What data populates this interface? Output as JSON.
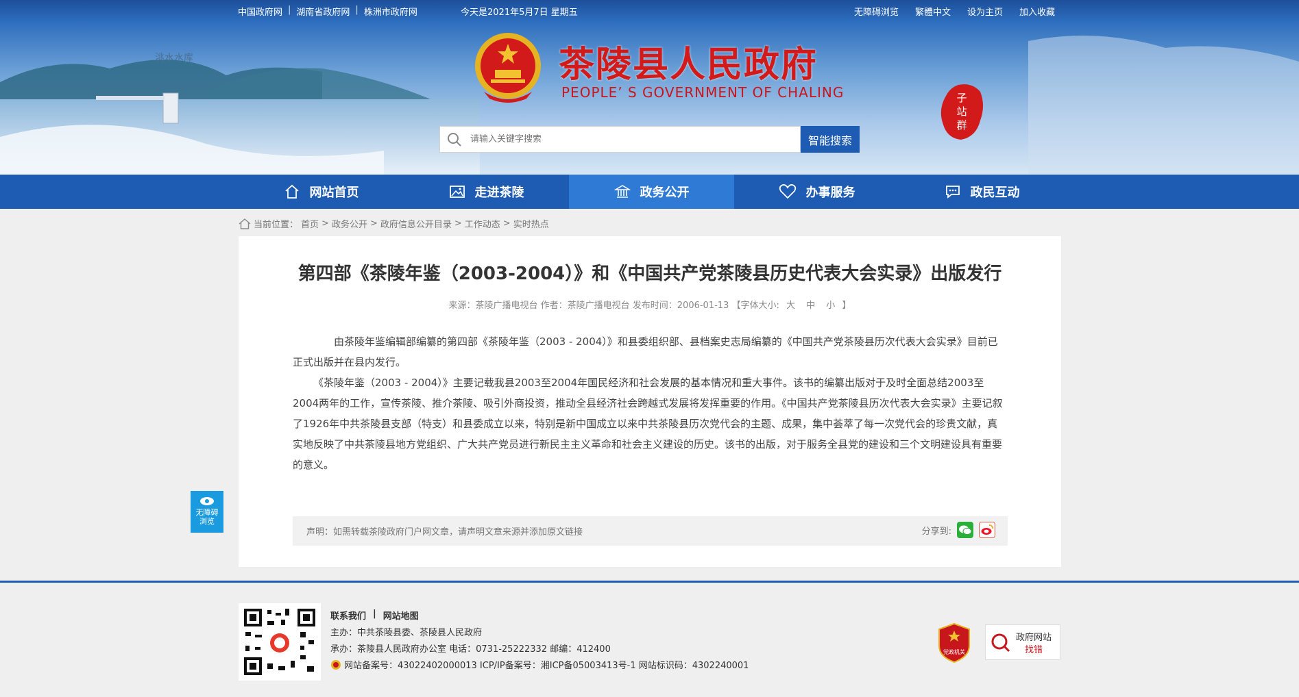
{
  "topbar": {
    "links_left": [
      "中国政府网",
      "湖南省政府网",
      "株洲市政府网"
    ],
    "separator": "|",
    "today": "今天是2021年5月7日 星期五",
    "links_right": [
      "无障碍浏览",
      "繁體中文",
      "设为主页",
      "加入收藏"
    ]
  },
  "header": {
    "title": "茶陵县人民政府",
    "subtitle": "PEOPLE’ S GOVERNMENT OF CHALING",
    "lake_label": "洮水水库",
    "station_group": [
      "子",
      "站",
      "群"
    ],
    "search_placeholder": "请输入关键字搜索",
    "search_button": "智能搜索"
  },
  "nav": {
    "items": [
      {
        "label": "网站首页",
        "icon": "home-icon"
      },
      {
        "label": "走进茶陵",
        "icon": "image-icon"
      },
      {
        "label": "政务公开",
        "icon": "government-icon",
        "active": true
      },
      {
        "label": "办事服务",
        "icon": "heart-icon"
      },
      {
        "label": "政民互动",
        "icon": "chat-icon"
      }
    ]
  },
  "breadcrumb": {
    "prefix": "当前位置：",
    "items": [
      "首页",
      "政务公开",
      "政府信息公开目录",
      "工作动态",
      "实时热点"
    ],
    "separator": ">"
  },
  "article": {
    "title": "第四部《茶陵年鉴（2003-2004）》和《中国共产党茶陵县历史代表大会实录》出版发行",
    "meta_prefix": "来源：茶陵广播电视台 作者：茶陵广播电视台 发布时间：2006-01-13 【字体大小:",
    "font_large": "大",
    "font_medium": "中",
    "font_small": "小",
    "meta_suffix": "】",
    "paragraphs": [
      "由茶陵年鉴编辑部编纂的第四部《茶陵年鉴（2003 - 2004）》和县委组织部、县档案史志局编纂的《中国共产党茶陵县历次代表大会实录》目前已正式出版并在县内发行。",
      "《茶陵年鉴（2003 - 2004）》主要记载我县2003至2004年国民经济和社会发展的基本情况和重大事件。该书的编纂出版对于及时全面总结2003至2004两年的工作，宣传茶陵、推介茶陵、吸引外商投资，推动全县经济社会跨越式发展将发挥重要的作用。《中国共产党茶陵县历次代表大会实录》主要记叙了1926年中共茶陵县支部（特支）和县委成立以来，特别是新中国成立以来中共茶陵县历次党代会的主题、成果，集中荟萃了每一次党代会的珍贵文献，真实地反映了中共茶陵县地方党组织、广大共产党员进行新民主主义革命和社会主义建设的历史。该书的出版，对于服务全县党的建设和三个文明建设具有重要的意义。"
    ],
    "declaration": "声明：如需转载茶陵政府门户网文章，请声明文章来源并添加原文链接",
    "share_label": "分享到:"
  },
  "float": {
    "line1": "无障碍",
    "line2": "浏览"
  },
  "footer": {
    "link_contact": "联系我们",
    "link_sitemap": "网站地图",
    "host": "主办：中共茶陵县委、茶陵县人民政府",
    "organizer": "承办：茶陵县人民政府办公室 电话：0731-25222332 邮编：412400",
    "record": "网站备案号：43022402000013 ICP/IP备案号：湘ICP备05003413号-1 网站标识码：4302240001",
    "badge_party": "党政机关",
    "badge_find_top": "政府网站",
    "badge_find_bottom": "找错"
  },
  "colors": {
    "primary": "#1d5cb2",
    "nav_active": "#2e7ad5",
    "title_red": "#d21a1a",
    "a11y_blue": "#1a9be0"
  }
}
